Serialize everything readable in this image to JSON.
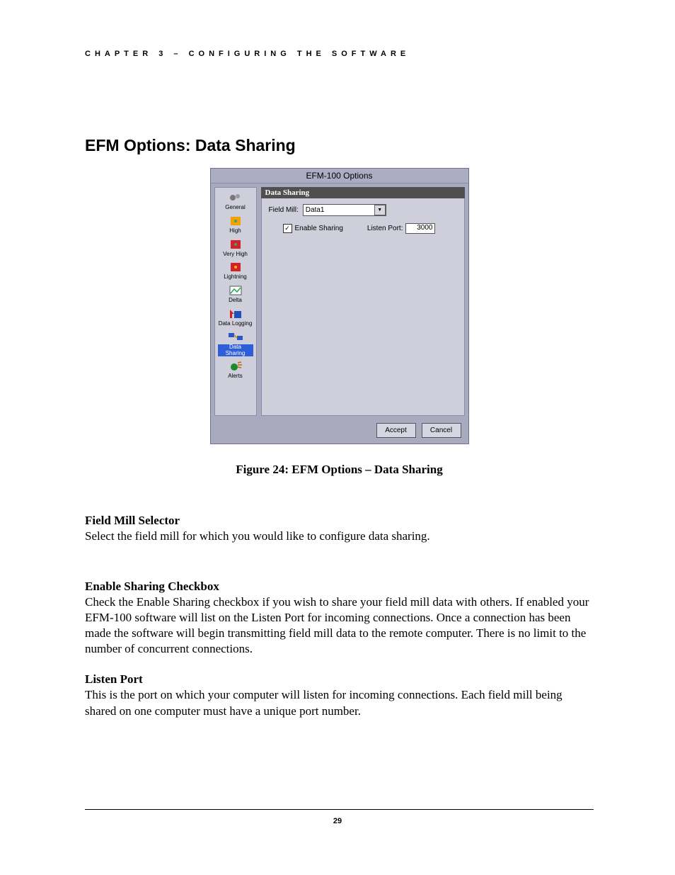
{
  "chapter_line": "CHAPTER 3 – CONFIGURING THE SOFTWARE",
  "section_heading": "EFM Options: Data Sharing",
  "figure_caption": "Figure 24:  EFM Options – Data Sharing",
  "sections": [
    {
      "title": "Field Mill Selector",
      "body": "Select the field mill for which you would like to configure data sharing."
    },
    {
      "title": "Enable Sharing Checkbox",
      "body": "Check the Enable Sharing checkbox if you wish to share your field mill data with others.  If enabled your EFM-100 software will list on the Listen Port for incoming connections.  Once a connection has been made the software will begin transmitting field mill data to the remote computer.  There is no limit to the number of concurrent connections."
    },
    {
      "title": "Listen Port",
      "body": "This is the port on which your computer will listen for incoming connections.  Each field mill being shared on one computer must have a unique port number."
    }
  ],
  "page_number": "29",
  "dialog": {
    "title": "EFM-100 Options",
    "panel_title": "Data Sharing",
    "field_mill_label": "Field Mill:",
    "field_mill_value": "Data1",
    "enable_sharing_label": "Enable Sharing",
    "enable_sharing_checked": true,
    "listen_port_label": "Listen Port:",
    "listen_port_value": "3000",
    "accept_label": "Accept",
    "cancel_label": "Cancel",
    "sidebar": [
      {
        "label": "General",
        "icon": "gears-icon",
        "selected": false
      },
      {
        "label": "High",
        "icon": "orange-dot-icon",
        "selected": false
      },
      {
        "label": "Very High",
        "icon": "red-dot-icon",
        "selected": false
      },
      {
        "label": "Lightning",
        "icon": "red-dot2-icon",
        "selected": false
      },
      {
        "label": "Delta",
        "icon": "chart-icon",
        "selected": false
      },
      {
        "label": "Data Logging",
        "icon": "disk-arrow-icon",
        "selected": false
      },
      {
        "label": "Data Sharing",
        "icon": "network-icon",
        "selected": true
      },
      {
        "label": "Alerts",
        "icon": "bell-icon",
        "selected": false
      }
    ]
  }
}
